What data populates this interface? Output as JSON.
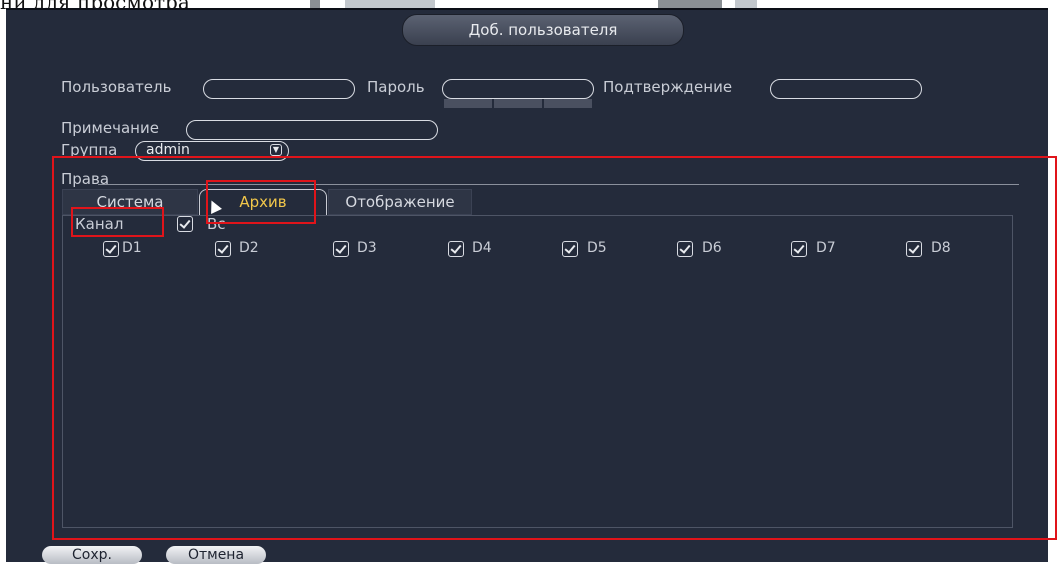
{
  "document": {
    "text": "ни для просмотра"
  },
  "dialog": {
    "title": "Доб. пользователя"
  },
  "form": {
    "user_label": "Пользователь",
    "user_value": "",
    "password_label": "Пароль",
    "password_value": "",
    "confirm_label": "Подтверждение",
    "confirm_value": "",
    "note_label": "Примечание",
    "note_value": "",
    "group_label": "Группа",
    "group_value": "admin"
  },
  "rights": {
    "label": "Права",
    "tabs": [
      {
        "label": "Система",
        "active": false
      },
      {
        "label": "Архив",
        "active": true
      },
      {
        "label": "Отображение",
        "active": false
      }
    ],
    "channel_label": "Канал",
    "all_label": "Вс",
    "channels": [
      "D1",
      "D2",
      "D3",
      "D4",
      "D5",
      "D6",
      "D7",
      "D8"
    ]
  },
  "buttons": {
    "save": "Сохр.",
    "cancel": "Отмена"
  },
  "colors": {
    "background": "#242b3b",
    "active_tab": "#f2c74a",
    "highlight": "#e0141a"
  }
}
